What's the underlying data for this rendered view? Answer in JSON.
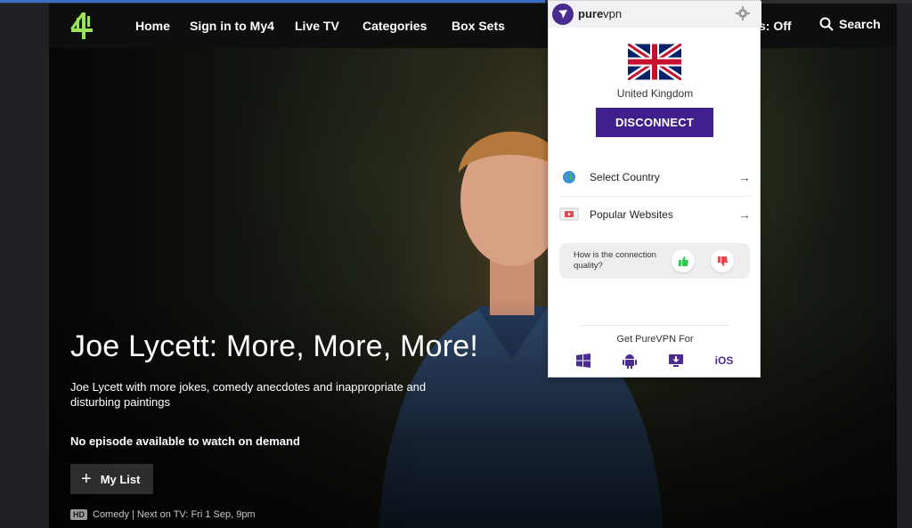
{
  "nav": {
    "items": [
      "Home",
      "Sign in to My4",
      "Live TV",
      "Categories",
      "Box Sets"
    ],
    "subtitles_partial": "s: Off",
    "search_label": "Search"
  },
  "show": {
    "title": "Joe Lycett: More, More, More!",
    "description": "Joe Lycett with more jokes, comedy anecdotes and inappropriate and disturbing paintings",
    "availability": "No episode available to watch on demand",
    "mylist_label": "My List",
    "hd_badge": "HD",
    "meta": "Comedy | Next on TV: Fri 1 Sep, 9pm"
  },
  "vpn": {
    "brand_bold": "pure",
    "brand_rest": "vpn",
    "country": "United Kingdom",
    "disconnect_label": "DISCONNECT",
    "menu": [
      {
        "label": "Select Country",
        "icon": "globe-icon"
      },
      {
        "label": "Popular Websites",
        "icon": "video-window-icon"
      }
    ],
    "feedback_question": "How is the connection quality?",
    "get_label": "Get PureVPN For",
    "platforms": [
      "windows-icon",
      "android-icon",
      "desktop-download-icon",
      "iOS"
    ],
    "colors": {
      "brand": "#3e1f8d",
      "thumb_up": "#34c759",
      "thumb_down": "#e5484d"
    }
  },
  "colors": {
    "c4_logo": "#9be15d",
    "nav_bg": "#0d0e0e"
  }
}
